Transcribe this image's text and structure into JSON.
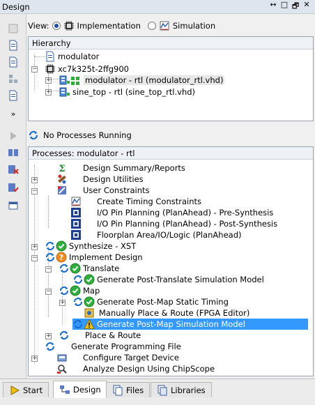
{
  "window": {
    "title": "Design",
    "controls": [
      "↔",
      "□",
      "🗗",
      "✕"
    ]
  },
  "view": {
    "label": "View:",
    "implementation": "Implementation",
    "simulation": "Simulation",
    "selected": "implementation"
  },
  "hierarchy": {
    "header": "Hierarchy",
    "items": [
      {
        "label": "modulator",
        "icon": "file-icon"
      },
      {
        "label": "xc7k325t-2ffg900",
        "icon": "chip-icon"
      },
      {
        "label": "modulator - rtl (modulator_rtl.vhd)",
        "icon": "top-module-icon"
      },
      {
        "label": "sine_top - rtl (sine_top_rtl.vhd)",
        "icon": "module-icon"
      }
    ]
  },
  "status": {
    "text": "No Processes Running"
  },
  "processes": {
    "header": "Processes: modulator - rtl",
    "items": [
      {
        "label": "Design Summary/Reports"
      },
      {
        "label": "Design Utilities"
      },
      {
        "label": "User Constraints"
      },
      {
        "label": "Create Timing Constraints"
      },
      {
        "label": "I/O Pin Planning (PlanAhead) - Pre-Synthesis"
      },
      {
        "label": "I/O Pin Planning (PlanAhead) - Post-Synthesis"
      },
      {
        "label": "Floorplan Area/IO/Logic (PlanAhead)"
      },
      {
        "label": "Synthesize - XST"
      },
      {
        "label": "Implement Design"
      },
      {
        "label": "Translate"
      },
      {
        "label": "Generate Post-Translate Simulation Model"
      },
      {
        "label": "Map"
      },
      {
        "label": "Generate Post-Map Static Timing"
      },
      {
        "label": "Manually Place & Route (FPGA Editor)"
      },
      {
        "label": "Generate Post-Map Simulation Model"
      },
      {
        "label": "Place & Route"
      },
      {
        "label": "Generate Programming File"
      },
      {
        "label": "Configure Target Device"
      },
      {
        "label": "Analyze Design Using ChipScope"
      }
    ]
  },
  "tabs": [
    {
      "label": "Start"
    },
    {
      "label": "Design"
    },
    {
      "label": "Files"
    },
    {
      "label": "Libraries"
    }
  ],
  "colors": {
    "selection": "#3399ff",
    "ok": "#2eae3b",
    "warn": "#f5b900",
    "question": "#f08a1c",
    "refresh": "#1b6fc9"
  }
}
